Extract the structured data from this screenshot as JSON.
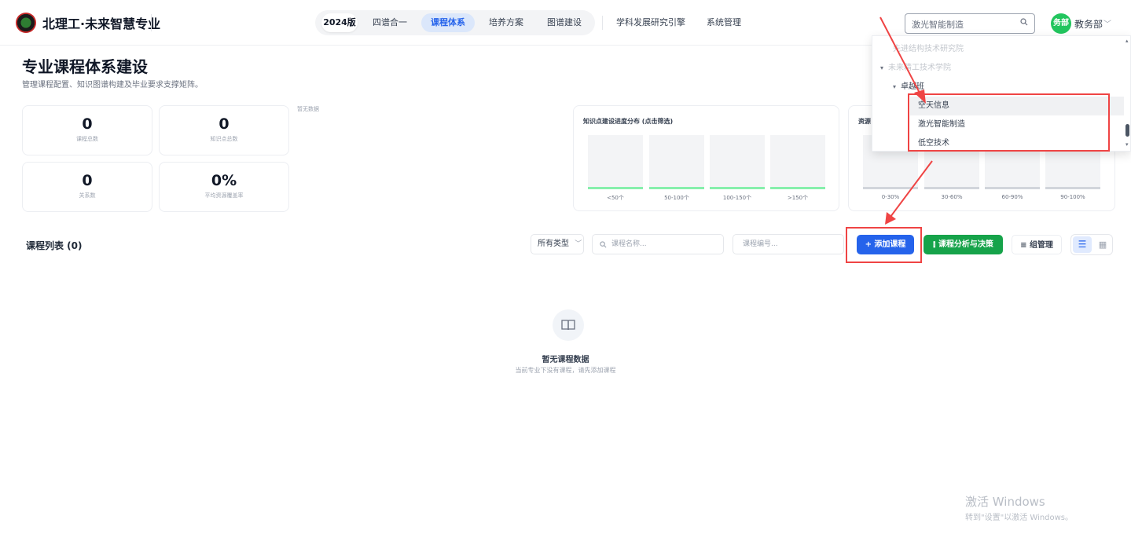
{
  "brand": {
    "name": "北理工·未来智慧专业",
    "logo_icon": "university-seal-icon"
  },
  "nav": {
    "items": [
      {
        "label": "2024版",
        "state": "badge"
      },
      {
        "label": "四谱合一",
        "state": "normal"
      },
      {
        "label": "课程体系",
        "state": "active"
      },
      {
        "label": "培养方案",
        "state": "normal"
      },
      {
        "label": "图谱建设",
        "state": "normal"
      },
      {
        "label": "学科发展研究引擎",
        "state": "normal"
      },
      {
        "label": "系统管理",
        "state": "normal"
      }
    ]
  },
  "search": {
    "value": "激光智能制造",
    "icon": "search-icon"
  },
  "user": {
    "avatar_text": "务部",
    "name": "教务部",
    "caret": "﹀",
    "color": "#22c55e"
  },
  "page": {
    "title": "专业课程体系建设",
    "subtitle": "管理课程配置、知识图谱构建及毕业要求支撑矩阵。"
  },
  "stats": [
    {
      "value": "0",
      "label": "课程总数"
    },
    {
      "value": "0",
      "label": "知识点总数"
    },
    {
      "value": "0",
      "label": "关系数"
    },
    {
      "value": "0%",
      "label": "平均资源覆盖率"
    }
  ],
  "no_data_label": "暂无数据",
  "chart_data": [
    {
      "type": "bar",
      "title": "知识点建设进度分布 (点击筛选)",
      "categories": [
        "<50个",
        "50-100个",
        "100-150个",
        ">150个"
      ],
      "values": [
        0,
        0,
        0,
        0
      ],
      "accent": "#86efac"
    },
    {
      "type": "bar",
      "title": "资源",
      "categories": [
        "0-30%",
        "30-60%",
        "60-90%",
        "90-100%"
      ],
      "values": [
        0,
        0,
        0,
        0
      ],
      "accent": "#d1d5db"
    }
  ],
  "list": {
    "title": "课程列表 (0)",
    "type_select": {
      "value": "所有类型",
      "caret": "﹀"
    },
    "name_placeholder": "课程名称...",
    "code_placeholder": "课程编号...",
    "add_button": "+ 添加课程",
    "analysis_button": "课程分析与决策",
    "group_button": "组管理",
    "view_list_icon": "list-view-icon",
    "view_grid_icon": "grid-view-icon"
  },
  "empty": {
    "title": "暂无课程数据",
    "subtitle": "当前专业下没有课程，请先添加课程",
    "icon": "book-open-icon"
  },
  "tree": {
    "rows": [
      {
        "label": "先进结构技术研究院",
        "faded": true
      },
      {
        "label": "未来精工技术学院",
        "faded": true,
        "caret": "▾"
      },
      {
        "label": "卓越班",
        "faded": false,
        "caret": "▾"
      },
      {
        "label": "空天信息",
        "faded": false,
        "hover": true
      },
      {
        "label": "激光智能制造",
        "faded": false
      },
      {
        "label": "低空技术",
        "faded": false
      }
    ]
  },
  "annotation_color": "#ef4444",
  "watermark": {
    "line1": "激活 Windows",
    "line2": "转到\"设置\"以激活 Windows。"
  }
}
